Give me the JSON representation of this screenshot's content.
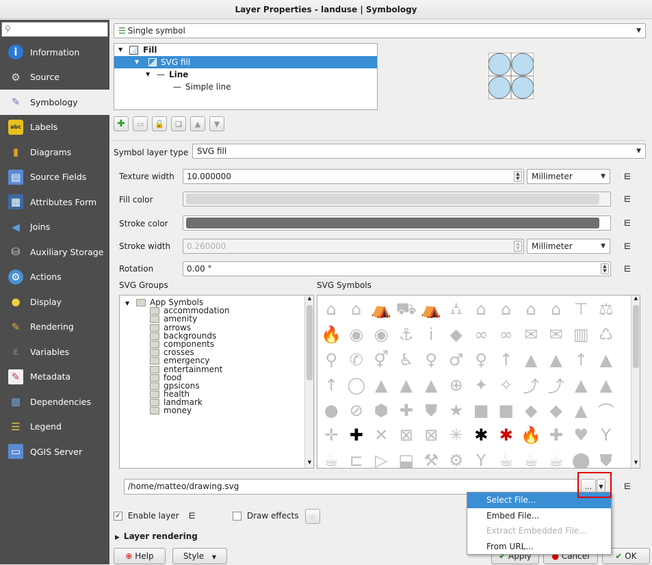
{
  "window": {
    "title": "Layer Properties - landuse | Symbology"
  },
  "sidebar": {
    "search_placeholder": "",
    "items": [
      {
        "label": "Information",
        "icon": "info-icon",
        "active": false
      },
      {
        "label": "Source",
        "icon": "source-icon",
        "active": false
      },
      {
        "label": "Symbology",
        "icon": "symbology-brush-icon",
        "active": true
      },
      {
        "label": "Labels",
        "icon": "labels-abc-icon",
        "active": false
      },
      {
        "label": "Diagrams",
        "icon": "diagrams-icon",
        "active": false
      },
      {
        "label": "Source Fields",
        "icon": "source-fields-icon",
        "active": false
      },
      {
        "label": "Attributes Form",
        "icon": "attributes-form-icon",
        "active": false
      },
      {
        "label": "Joins",
        "icon": "joins-icon",
        "active": false
      },
      {
        "label": "Auxiliary Storage",
        "icon": "auxiliary-storage-icon",
        "active": false
      },
      {
        "label": "Actions",
        "icon": "actions-gear-icon",
        "active": false
      },
      {
        "label": "Display",
        "icon": "display-bubble-icon",
        "active": false
      },
      {
        "label": "Rendering",
        "icon": "rendering-brush-icon",
        "active": false
      },
      {
        "label": "Variables",
        "icon": "variables-epsilon-icon",
        "active": false
      },
      {
        "label": "Metadata",
        "icon": "metadata-icon",
        "active": false
      },
      {
        "label": "Dependencies",
        "icon": "dependencies-icon",
        "active": false
      },
      {
        "label": "Legend",
        "icon": "legend-icon",
        "active": false
      },
      {
        "label": "QGIS Server",
        "icon": "qgis-server-icon",
        "active": false
      }
    ]
  },
  "renderer": {
    "value": "Single symbol"
  },
  "symbol_tree": {
    "fill": "Fill",
    "svg_fill": "SVG fill",
    "line": "Line",
    "simple_line": "Simple line"
  },
  "symbol_layer_type": {
    "label": "Symbol layer type",
    "value": "SVG fill"
  },
  "texture_width": {
    "label": "Texture width",
    "value": "10.000000",
    "unit": "Millimeter"
  },
  "fill_color": {
    "label": "Fill color",
    "color": "#d8d8d8"
  },
  "stroke_color": {
    "label": "Stroke color",
    "color": "#6e6e6e"
  },
  "stroke_width": {
    "label": "Stroke width",
    "value": "0.260000",
    "unit": "Millimeter"
  },
  "rotation": {
    "label": "Rotation",
    "value": "0.00 °"
  },
  "svg_groups": {
    "label": "SVG Groups",
    "root": "App Symbols",
    "folders": [
      "accommodation",
      "amenity",
      "arrows",
      "backgrounds",
      "components",
      "crosses",
      "emergency",
      "entertainment",
      "food",
      "gpsicons",
      "health",
      "landmark",
      "money"
    ]
  },
  "svg_symbols": {
    "label": "SVG Symbols",
    "rows": [
      [
        "⌂",
        "⌂",
        "⛺",
        "⛟",
        "⛺",
        "⛼",
        "⌂",
        "⌂",
        "⌂",
        "⌂",
        "⊤",
        "⚖"
      ],
      [
        "🔥",
        "◉",
        "◉",
        "⚓",
        "i",
        "◆",
        "∞",
        "∞",
        "✉",
        "✉",
        "▥",
        "♺"
      ],
      [
        "⚲",
        "✆",
        "⚥",
        "♿",
        "♀",
        "♂",
        "♀",
        "↑",
        "▲",
        "▲",
        "↑",
        "▲"
      ],
      [
        "↑",
        "◯",
        "▲",
        "▲",
        "▲",
        "⊕",
        "✦",
        "✧",
        "⤴",
        "⤴",
        "▲",
        "▲"
      ],
      [
        "●",
        "⊘",
        "⬢",
        "✚",
        "⛊",
        "★",
        "■",
        "■",
        "◆",
        "◆",
        "▲",
        "⌒"
      ],
      [
        "✛",
        "✚",
        "✕",
        "⊠",
        "⊠",
        "✳",
        "✱",
        "✱",
        "🔥",
        "✚",
        "♥",
        "Y"
      ],
      [
        "☕",
        "⊏",
        "▷",
        "⬓",
        "⚒",
        "⚙",
        "Y",
        "☕",
        "☕",
        "☕",
        "⬤",
        "⛊"
      ]
    ],
    "highlight": {
      "row5_col1": "#000000",
      "row5_col6": "#000000",
      "row5_col7": "#d00000"
    }
  },
  "svg_path": {
    "value": "/home/matteo/drawing.svg",
    "browse_label": "..."
  },
  "context_menu": {
    "items": [
      {
        "label": "Select File...",
        "state": "highlighted"
      },
      {
        "label": "Embed File...",
        "state": "normal"
      },
      {
        "label": "Extract Embedded File...",
        "state": "disabled"
      },
      {
        "label": "From URL...",
        "state": "normal"
      }
    ]
  },
  "enable_layer": {
    "label": "Enable layer",
    "checked": true
  },
  "draw_effects": {
    "label": "Draw effects",
    "checked": false
  },
  "layer_rendering": {
    "label": "Layer rendering"
  },
  "buttons": {
    "help": "Help",
    "style": "Style",
    "apply": "Apply",
    "cancel": "Cancel",
    "ok": "OK"
  }
}
